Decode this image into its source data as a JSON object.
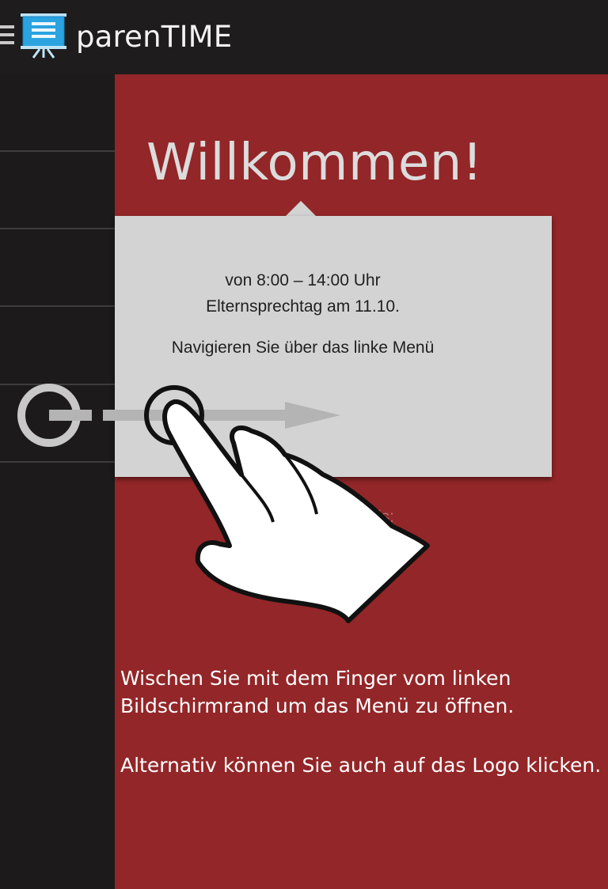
{
  "app": {
    "title": "parenTIME"
  },
  "main": {
    "welcome_title": "Willkommen!",
    "info_card": {
      "line1": "von 8:00 – 14:00 Uhr",
      "line2": "Elternsprechtag am 11.10.",
      "line3": "Navigieren Sie über das linke Menü"
    },
    "partial_label": "ls:"
  },
  "tutorial": {
    "hint_line1": "Wischen Sie mit dem Finger vom linken",
    "hint_line2": "Bildschirmrand um das Menü zu öffnen.",
    "hint_line3": "Alternativ können Sie auch auf das Logo klicken."
  },
  "colors": {
    "brand_red": "#932628",
    "action_bar": "#1e1c1c",
    "card_gray": "#d3d3d3",
    "logo_blue": "#2aa3e0"
  },
  "icons": {
    "menu": "hamburger-icon",
    "logo": "presentation-board-icon",
    "gesture": "swipe-hand-icon"
  }
}
